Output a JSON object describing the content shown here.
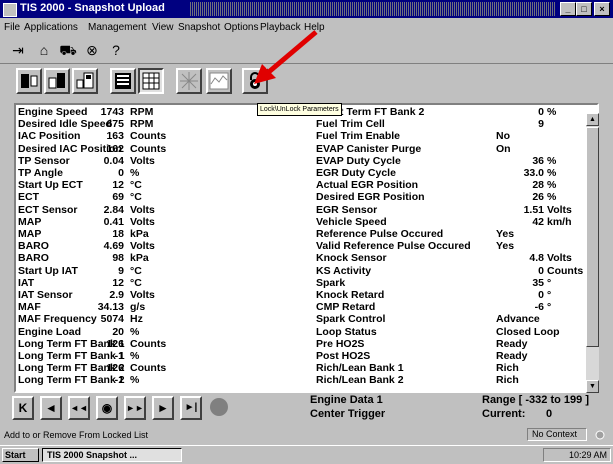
{
  "window": {
    "title": "TIS 2000 - Snapshot Upload",
    "buttons": [
      "_",
      "□",
      "×"
    ]
  },
  "menu": [
    {
      "label": "File"
    },
    {
      "label": "Applications"
    },
    {
      "label": "Management"
    },
    {
      "label": "View"
    },
    {
      "label": "Snapshot"
    },
    {
      "label": "Options"
    },
    {
      "label": "Playback"
    },
    {
      "label": "Help"
    }
  ],
  "toolbar1": {
    "icons": [
      "exit-icon",
      "home-icon",
      "vehicle-icon",
      "stop-icon",
      "help-icon"
    ]
  },
  "toolbar2": {
    "icons": [
      "scan-tool-icon",
      "obd-icon",
      "ecu-icon",
      "data-list-icon",
      "grid-icon",
      "snapshot-icon",
      "graph-icon",
      "lock-icon"
    ]
  },
  "tooltip": "Lock\\UnLock Parameters",
  "params": [
    {
      "name": "Engine Speed",
      "value": "1743",
      "unit": "RPM",
      "name2": "Short Term FT Bank 2",
      "value2": "0",
      "unit2": "%"
    },
    {
      "name": "Desired Idle Speed",
      "value": "675",
      "unit": "RPM",
      "name2": "Fuel Trim Cell",
      "value2": "9",
      "unit2": ""
    },
    {
      "name": "IAC Position",
      "value": "163",
      "unit": "Counts",
      "name2": "Fuel Trim Enable",
      "value2": "No",
      "unit2": ""
    },
    {
      "name": "Desired IAC Position",
      "value": "162",
      "unit": "Counts",
      "name2": "EVAP Canister Purge",
      "value2": "On",
      "unit2": ""
    },
    {
      "name": "TP Sensor",
      "value": "0.04",
      "unit": "Volts",
      "name2": "EVAP Duty Cycle",
      "value2": "36",
      "unit2": "%"
    },
    {
      "name": "TP Angle",
      "value": "0",
      "unit": "%",
      "name2": "EGR Duty Cycle",
      "value2": "33.0",
      "unit2": "%"
    },
    {
      "name": "Start Up ECT",
      "value": "12",
      "unit": "°C",
      "name2": "Actual EGR Position",
      "value2": "28",
      "unit2": "%"
    },
    {
      "name": "ECT",
      "value": "69",
      "unit": "°C",
      "name2": "Desired EGR Position",
      "value2": "26",
      "unit2": "%"
    },
    {
      "name": "ECT Sensor",
      "value": "2.84",
      "unit": "Volts",
      "name2": "EGR Sensor",
      "value2": "1.51",
      "unit2": "Volts"
    },
    {
      "name": "MAP",
      "value": "0.41",
      "unit": "Volts",
      "name2": "Vehicle Speed",
      "value2": "42",
      "unit2": "km/h"
    },
    {
      "name": "MAP",
      "value": "18",
      "unit": "kPa",
      "name2": "Reference Pulse Occured",
      "value2": "Yes",
      "unit2": ""
    },
    {
      "name": "BARO",
      "value": "4.69",
      "unit": "Volts",
      "name2": "Valid Reference Pulse Occured",
      "value2": "Yes",
      "unit2": ""
    },
    {
      "name": "BARO",
      "value": "98",
      "unit": "kPa",
      "name2": "Knock Sensor",
      "value2": "4.8",
      "unit2": "Volts"
    },
    {
      "name": "Start Up IAT",
      "value": "9",
      "unit": "°C",
      "name2": "KS Activity",
      "value2": "0",
      "unit2": "Counts"
    },
    {
      "name": "IAT",
      "value": "12",
      "unit": "°C",
      "name2": "Spark",
      "value2": "35",
      "unit2": "°"
    },
    {
      "name": "IAT Sensor",
      "value": "2.9",
      "unit": "Volts",
      "name2": "Knock Retard",
      "value2": "0",
      "unit2": "°"
    },
    {
      "name": "MAF",
      "value": "34.13",
      "unit": "g/s",
      "name2": "CMP Retard",
      "value2": "-6",
      "unit2": "°"
    },
    {
      "name": "MAF Frequency",
      "value": "5074",
      "unit": "Hz",
      "name2": "Spark Control",
      "value2": "Advance",
      "unit2": ""
    },
    {
      "name": "Engine Load",
      "value": "20",
      "unit": "%",
      "name2": "Loop Status",
      "value2": "Closed Loop",
      "unit2": ""
    },
    {
      "name": "Long Term FT Bank 1",
      "value": "126",
      "unit": "Counts",
      "name2": "Pre HO2S",
      "value2": "Ready",
      "unit2": ""
    },
    {
      "name": "Long Term FT Bank 1",
      "value": "-1",
      "unit": "%",
      "name2": "Post HO2S",
      "value2": "Ready",
      "unit2": ""
    },
    {
      "name": "Long Term FT Bank 2",
      "value": "126",
      "unit": "Counts",
      "name2": "Rich/Lean Bank 1",
      "value2": "Rich",
      "unit2": ""
    },
    {
      "name": "Long Term FT Bank 2",
      "value": "-1",
      "unit": "%",
      "name2": "Rich/Lean Bank 2",
      "value2": "Rich",
      "unit2": ""
    }
  ],
  "nav": {
    "buttons": [
      "K",
      "◄",
      "◄◄",
      "◉",
      "►►",
      "►",
      "►|",
      "●"
    ],
    "engine_data": "Engine Data 1",
    "trigger": "Center Trigger",
    "range": "Range [ -332 to 199 ]",
    "current_label": "Current:",
    "current_value": "0"
  },
  "status": {
    "text": "Add to or Remove From Locked List",
    "context": "No Context"
  },
  "taskbar": {
    "start": "Start",
    "task": "TIS 2000 Snapshot ...",
    "clock": "10:29 AM"
  }
}
